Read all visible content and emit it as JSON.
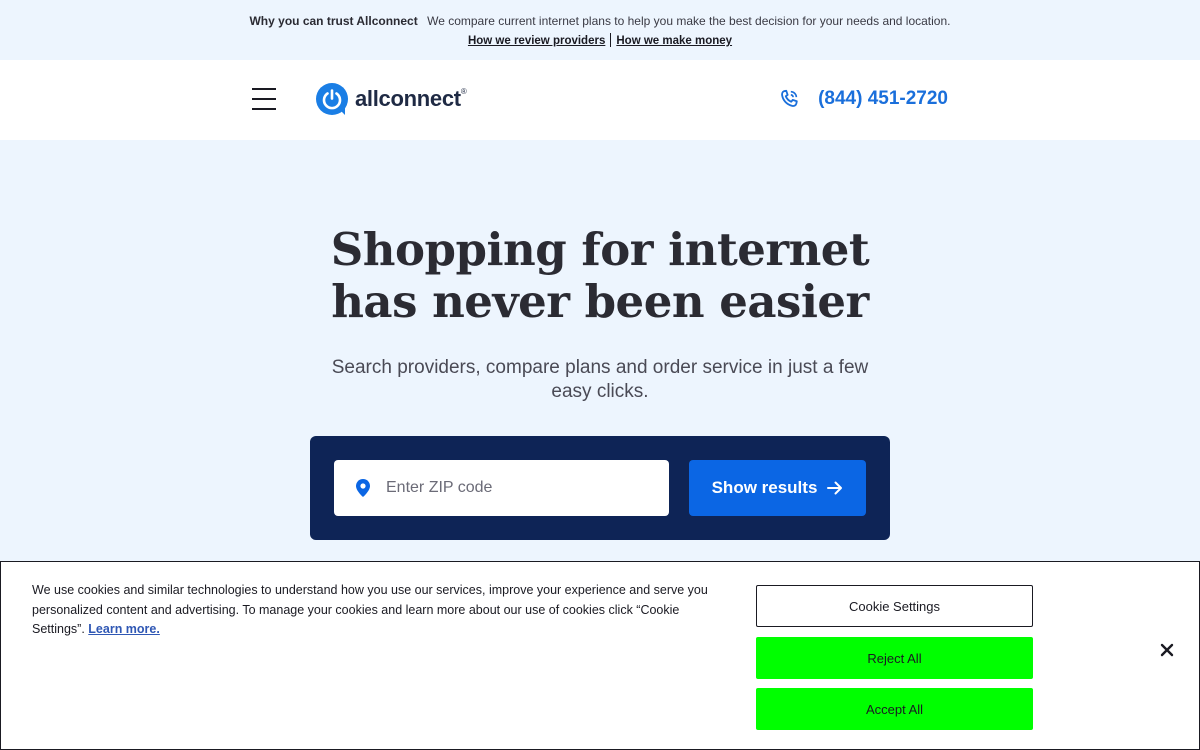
{
  "trust_bar": {
    "title": "Why you can trust Allconnect",
    "text": "We compare current internet plans to help you make the best decision for your needs and location.",
    "link_review": "How we review providers",
    "link_money": "How we make money"
  },
  "header": {
    "logo_text": "allconnect",
    "logo_reg": "®",
    "phone": "(844) 451-2720"
  },
  "hero": {
    "title_line1": "Shopping for internet",
    "title_line2": "has never been easier",
    "subtitle": "Search providers, compare plans and order service in just a few easy clicks."
  },
  "search": {
    "zip_placeholder": "Enter ZIP code",
    "zip_value": "",
    "button_label": "Show results"
  },
  "cookie": {
    "text": "We use cookies and similar technologies to understand how you use our services, improve your experience and serve you personalized content and advertising. To manage your cookies and learn more about our use of cookies click “Cookie Settings”.",
    "learn_more": "Learn more.",
    "settings_label": "Cookie Settings",
    "reject_label": "Reject All",
    "accept_label": "Accept All"
  },
  "colors": {
    "brand_blue": "#1a6fdb",
    "navy": "#0e2456",
    "cookie_green": "#00ff00",
    "page_bg": "#edf5fe"
  }
}
